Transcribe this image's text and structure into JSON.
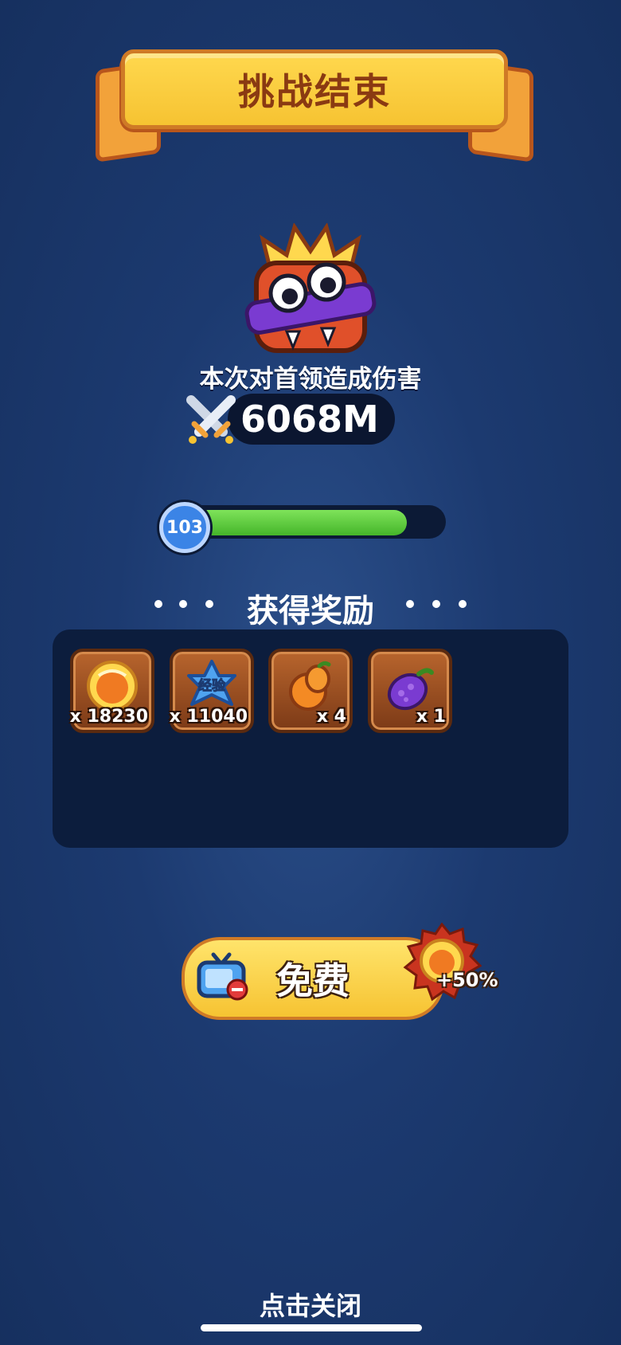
{
  "title": "挑战结束",
  "damage": {
    "caption": "本次对首领造成伤害",
    "value": "6068M"
  },
  "level": {
    "number": "103",
    "progress": 0.88
  },
  "rewards": {
    "heading": "获得奖励",
    "items": [
      {
        "icon": "gold-coin-icon",
        "quantity": "x 18230"
      },
      {
        "icon": "experience-star-icon",
        "label": "经验",
        "quantity": "x 11040"
      },
      {
        "icon": "orange-fruit-icon",
        "quantity": "x 4"
      },
      {
        "icon": "purple-eggplant-icon",
        "quantity": "x 1"
      }
    ]
  },
  "free_button": {
    "label": "免费",
    "icon": "tv-ad-icon",
    "bonus": "+50%",
    "bonus_icon": "gold-coin-icon"
  },
  "close_label": "点击关闭",
  "colors": {
    "background": "#1c3a70",
    "ribbon": "#f6c332",
    "title_text": "#8a3a12",
    "progress_fill": "#45b52a",
    "reward_tile": "#9a4d22"
  }
}
